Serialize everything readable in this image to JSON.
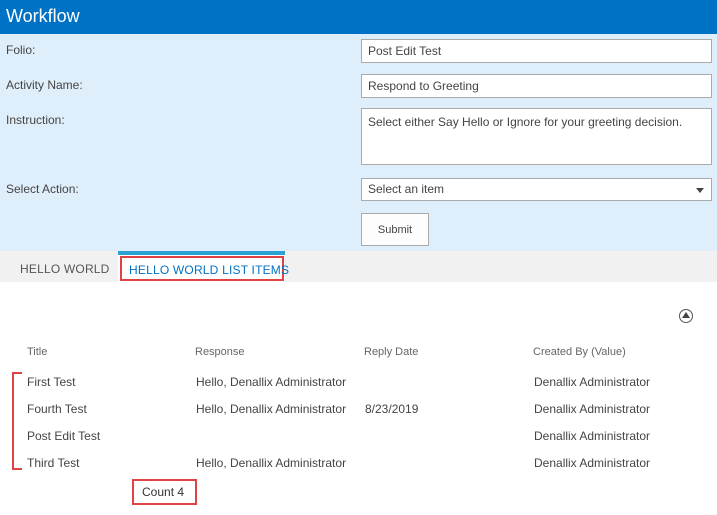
{
  "window": {
    "title": "Workflow"
  },
  "form": {
    "folio_label": "Folio:",
    "folio_value": "Post Edit Test",
    "activity_label": "Activity Name:",
    "activity_value": "Respond to Greeting",
    "instruction_label": "Instruction:",
    "instruction_value": "Select either Say Hello or Ignore for your greeting decision.",
    "action_label": "Select Action:",
    "action_selected": "Select an item",
    "submit_label": "Submit"
  },
  "tabs": [
    {
      "label": "HELLO WORLD",
      "active": false
    },
    {
      "label": "HELLO WORLD LIST ITEMS",
      "active": true
    }
  ],
  "list": {
    "columns": [
      "Title",
      "Response",
      "Reply Date",
      "Created By (Value)"
    ],
    "rows": [
      {
        "title": "First Test",
        "response": "Hello, Denallix Administrator",
        "reply_date": "",
        "created_by": "Denallix Administrator"
      },
      {
        "title": "Fourth Test",
        "response": "Hello, Denallix Administrator",
        "reply_date": "8/23/2019",
        "created_by": "Denallix Administrator"
      },
      {
        "title": "Post Edit Test",
        "response": "",
        "reply_date": "",
        "created_by": "Denallix Administrator"
      },
      {
        "title": "Third Test",
        "response": "Hello, Denallix Administrator",
        "reply_date": "",
        "created_by": "Denallix Administrator"
      }
    ],
    "count_label": "Count",
    "count_value": "4"
  },
  "colors": {
    "title_bar": "#0072c6",
    "form_background": "#dfeefb",
    "active_tab_accent": "#2aa2d6",
    "highlight": "#e04343"
  },
  "icons": {
    "collapse": "chevron-up-circle-icon",
    "dropdown": "chevron-down-icon"
  }
}
